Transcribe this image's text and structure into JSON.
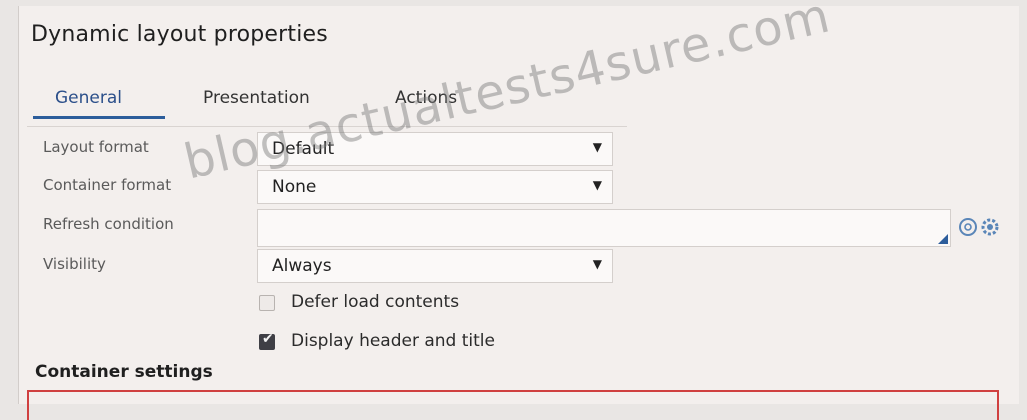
{
  "panel": {
    "title": "Dynamic layout properties"
  },
  "tabs": [
    {
      "label": "General",
      "active": true
    },
    {
      "label": "Presentation",
      "active": false
    },
    {
      "label": "Actions",
      "active": false
    }
  ],
  "fields": {
    "layout_format": {
      "label": "Layout format",
      "value": "Default"
    },
    "container_format": {
      "label": "Container format",
      "value": "None"
    },
    "refresh_condition": {
      "label": "Refresh condition",
      "value": ""
    },
    "visibility": {
      "label": "Visibility",
      "value": "Always"
    }
  },
  "checkboxes": [
    {
      "label": "Defer load contents",
      "checked": false
    },
    {
      "label": "Display header and title",
      "checked": true
    }
  ],
  "sections": {
    "container_settings": "Container settings"
  },
  "watermark": "blog.actualtests4sure.com",
  "icons": {
    "caret": "dropdown-caret-icon",
    "add_condition": "condition-builder-icon",
    "settings": "gear-icon"
  },
  "colors": {
    "accent": "#2c5d9b",
    "highlight_border": "#d04040"
  }
}
